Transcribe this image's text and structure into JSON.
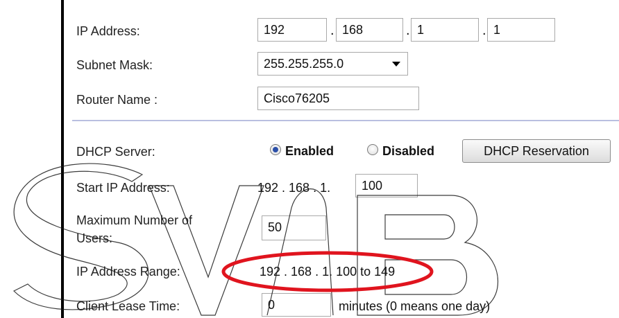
{
  "lan": {
    "ip_label": "IP Address:",
    "ip_octets": [
      "192",
      "168",
      "1",
      "1"
    ],
    "subnet_label": "Subnet Mask:",
    "subnet_value": "255.255.255.0",
    "router_name_label": "Router Name :",
    "router_name_value": "Cisco76205"
  },
  "dhcp": {
    "server_label": "DHCP Server:",
    "enabled_label": "Enabled",
    "disabled_label": "Disabled",
    "selected": "Enabled",
    "reservation_button": "DHCP Reservation",
    "start_ip_label": "Start IP Address:",
    "start_ip_prefix": "192 . 168 . 1.",
    "start_ip_last": "100",
    "max_users_label_line1": "Maximum Number of",
    "max_users_label_line2": "Users:",
    "max_users_value": "50",
    "range_label": "IP Address Range:",
    "range_value": "192 . 168 . 1. 100 to 149",
    "lease_label": "Client Lease Time:",
    "lease_value": "0",
    "lease_hint": "minutes (0 means one day)"
  },
  "annotation": {
    "highlight_color": "#e0141e",
    "watermark": "SVB"
  }
}
